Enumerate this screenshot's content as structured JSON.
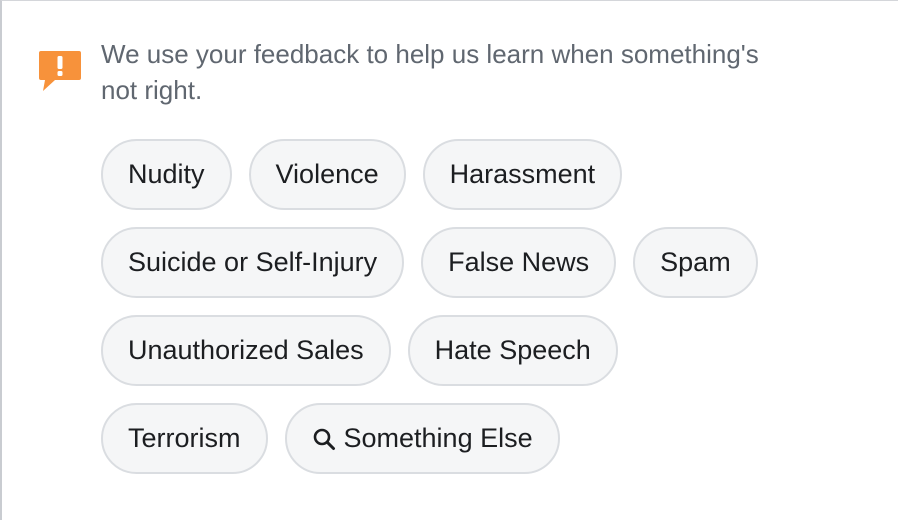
{
  "message": "We use your feedback to help us learn when something's not right.",
  "icon": {
    "name": "exclamation-icon",
    "color": "#f7923b"
  },
  "chip_rows": [
    [
      {
        "label": "Nudity"
      },
      {
        "label": "Violence"
      },
      {
        "label": "Harassment"
      }
    ],
    [
      {
        "label": "Suicide or Self-Injury"
      },
      {
        "label": "False News"
      },
      {
        "label": "Spam"
      }
    ],
    [
      {
        "label": "Unauthorized Sales"
      },
      {
        "label": "Hate Speech"
      }
    ],
    [
      {
        "label": "Terrorism"
      },
      {
        "label": "Something Else",
        "icon": "search-icon"
      }
    ]
  ]
}
